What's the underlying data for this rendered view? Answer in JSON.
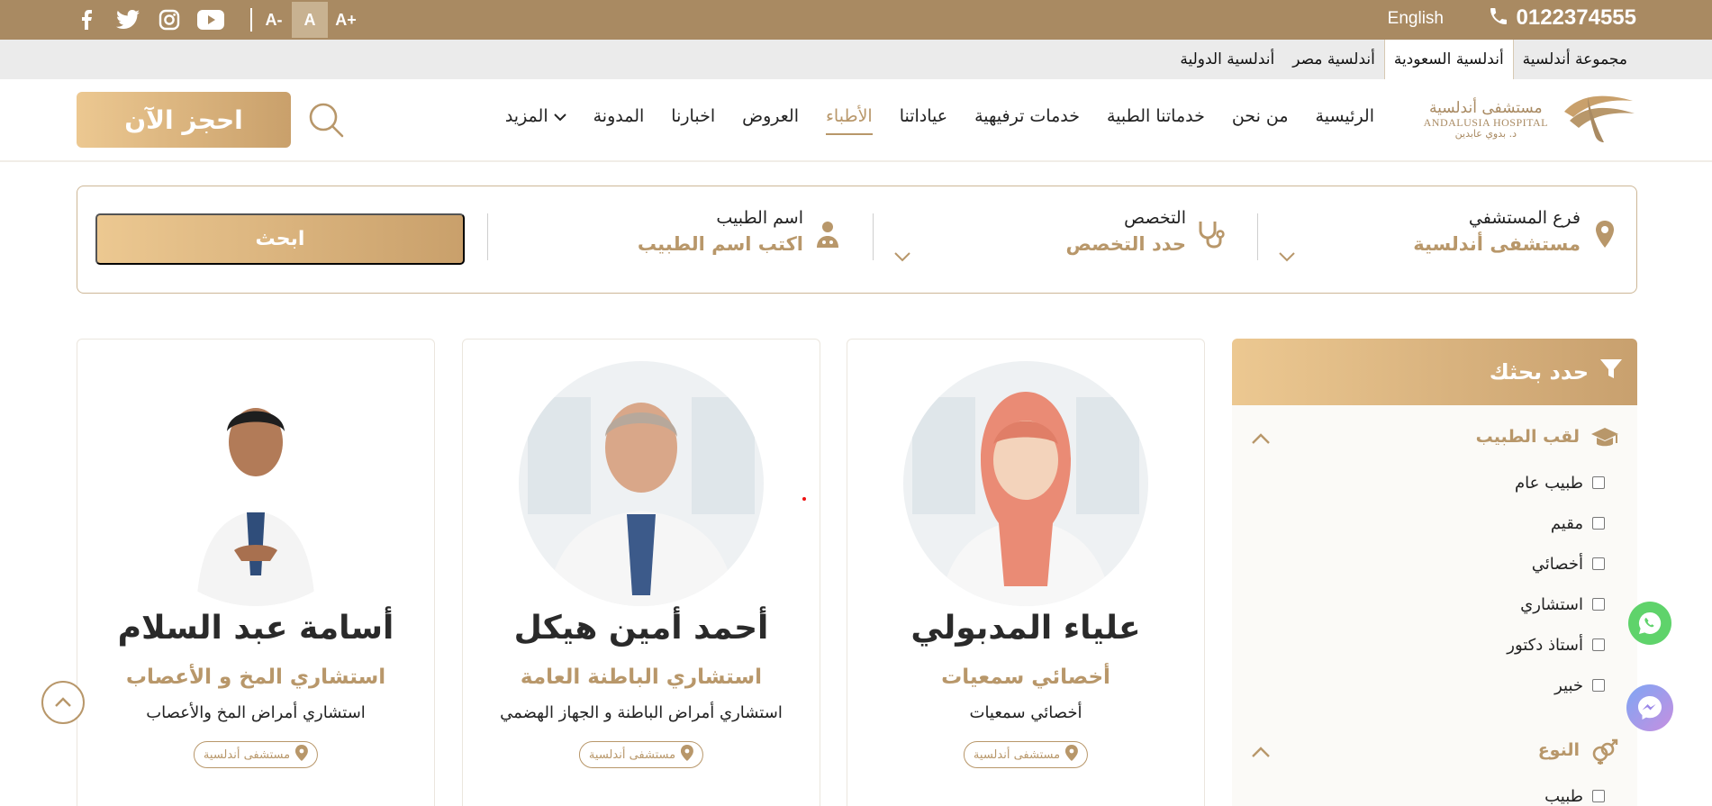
{
  "topbar": {
    "font_smaller": "A-",
    "font_normal": "A",
    "font_larger": "A+",
    "language": "English",
    "phone": "0122374555",
    "social": [
      "facebook-icon",
      "twitter-icon",
      "instagram-icon",
      "youtube-icon"
    ]
  },
  "group_tabs": [
    {
      "label": "مجموعة أندلسية"
    },
    {
      "label": "أندلسية السعودية"
    },
    {
      "label": "أندلسية مصر"
    },
    {
      "label": "أندلسية الدولية"
    }
  ],
  "logo": {
    "ar": "مستشفى أندلسية",
    "en": "ANDALUSIA HOSPITAL",
    "ar_small": "د. بدوي عابدين"
  },
  "nav": {
    "items": [
      {
        "label": "الرئيسية"
      },
      {
        "label": "من نحن"
      },
      {
        "label": "خدماتنا الطبية"
      },
      {
        "label": "خدمات ترفيهية"
      },
      {
        "label": "عياداتنا"
      },
      {
        "label": "الأطباء"
      },
      {
        "label": "العروض"
      },
      {
        "label": "اخبارنا"
      },
      {
        "label": "المدونة"
      },
      {
        "label": "المزيد"
      }
    ],
    "book_now": "احجز الآن"
  },
  "search_bar": {
    "branch": {
      "label": "فرع المستشفي",
      "value": "مستشفى أندلسية"
    },
    "specialty": {
      "label": "التخصص",
      "value": "حدد التخصص"
    },
    "doctor": {
      "label": "اسم الطبيب",
      "placeholder": "اكتب اسم الطبيب"
    },
    "submit": "ابحث"
  },
  "filter": {
    "title": "حدد بحثك",
    "sections": [
      {
        "title": "لقب الطبيب",
        "options": [
          "طبيب عام",
          "مقيم",
          "أخصائي",
          "استشاري",
          "أستاذ دكتور",
          "خبير"
        ]
      },
      {
        "title": "النوع",
        "options": [
          "طبيب"
        ]
      }
    ]
  },
  "doctors": [
    {
      "name": "علياء المدبولي",
      "title": "أخصائي سمعيات",
      "desc": "أخصائي سمعيات",
      "branch": "مستشفى أندلسية"
    },
    {
      "name": "أحمد أمين هيكل",
      "title": "استشاري الباطنة العامة",
      "desc": "استشاري أمراض الباطنة و الجهاز الهضمي",
      "branch": "مستشفى أندلسية"
    },
    {
      "name": "أسامة عبد السلام",
      "title": "استشاري المخ و الأعصاب",
      "desc": "استشاري أمراض المخ والأعصاب",
      "branch": "مستشفى أندلسية"
    }
  ],
  "colors": {
    "brand": "#a98a62",
    "gold": "#b8976a",
    "gradient_start": "#ecc891",
    "gradient_end": "#c9a06b"
  }
}
